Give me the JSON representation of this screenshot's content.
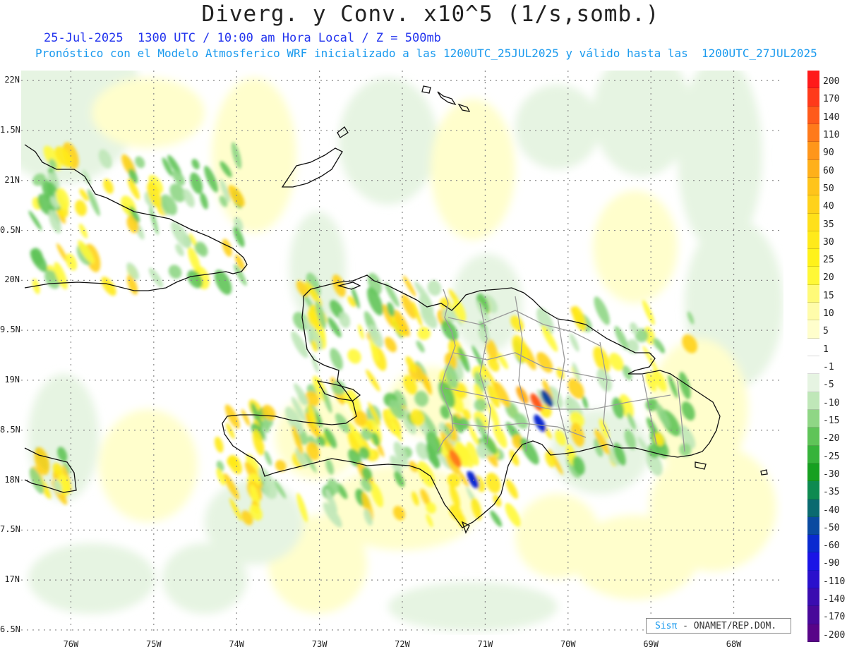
{
  "title": "Diverg. y Conv. x10^5 (1/s,somb.)",
  "subtitle_line1": "25-Jul-2025  1300 UTC / 10:00 am Hora Local / Z = 500mb",
  "subtitle_line2": "Pronóstico con el Modelo Atmosferico WRF inicializado a las 1200UTC_25JUL2025 y válido hasta las  1200UTC_27JUL2025",
  "map": {
    "lat_labels": [
      "22N",
      "1.5N",
      "21N",
      "0.5N",
      "20N",
      "9.5N",
      "19N",
      "8.5N",
      "18N",
      "7.5N",
      "17N",
      "6.5N"
    ],
    "lon_labels": [
      "76W",
      "75W",
      "74W",
      "73W",
      "72W",
      "71W",
      "70W",
      "69W",
      "68W"
    ],
    "lat_values": [
      22,
      21.5,
      21,
      20.5,
      20,
      19.5,
      19,
      18.5,
      18,
      17.5,
      17,
      16.5
    ],
    "lon_values": [
      -76,
      -75,
      -74,
      -73,
      -72,
      -71,
      -70,
      -69,
      -68
    ],
    "extent": {
      "lon_min": -76.6,
      "lon_max": -67.4,
      "lat_min": 16.45,
      "lat_max": 22.1
    },
    "gridline_style": "dotted"
  },
  "colorbar": {
    "labels": [
      "200",
      "170",
      "140",
      "110",
      "90",
      "60",
      "50",
      "40",
      "35",
      "30",
      "25",
      "20",
      "15",
      "10",
      "5",
      "1",
      "-1",
      "-5",
      "-10",
      "-15",
      "-20",
      "-25",
      "-30",
      "-35",
      "-40",
      "-50",
      "-60",
      "-90",
      "-110",
      "-140",
      "-170",
      "-200"
    ],
    "colors": [
      "#ff1a1a",
      "#ff3a1a",
      "#ff5a1a",
      "#ff7a1a",
      "#ff961a",
      "#ffb01a",
      "#ffc41a",
      "#ffd21a",
      "#ffe01a",
      "#ffea1a",
      "#fff21a",
      "#fff836",
      "#fffa78",
      "#fffcaa",
      "#fffecc",
      "#ffffff",
      "#ffffff",
      "#e6f4e2",
      "#bfe7b8",
      "#8fd685",
      "#5fc458",
      "#36b33a",
      "#16a020",
      "#0d8a50",
      "#0a6a70",
      "#0a4aa0",
      "#0a2ad0",
      "#1a14e6",
      "#2a10cc",
      "#3a0cb0",
      "#48089a",
      "#580488"
    ]
  },
  "credit": {
    "brand": "Sisπ",
    "text": " - ONAMET/REP.DOM."
  }
}
